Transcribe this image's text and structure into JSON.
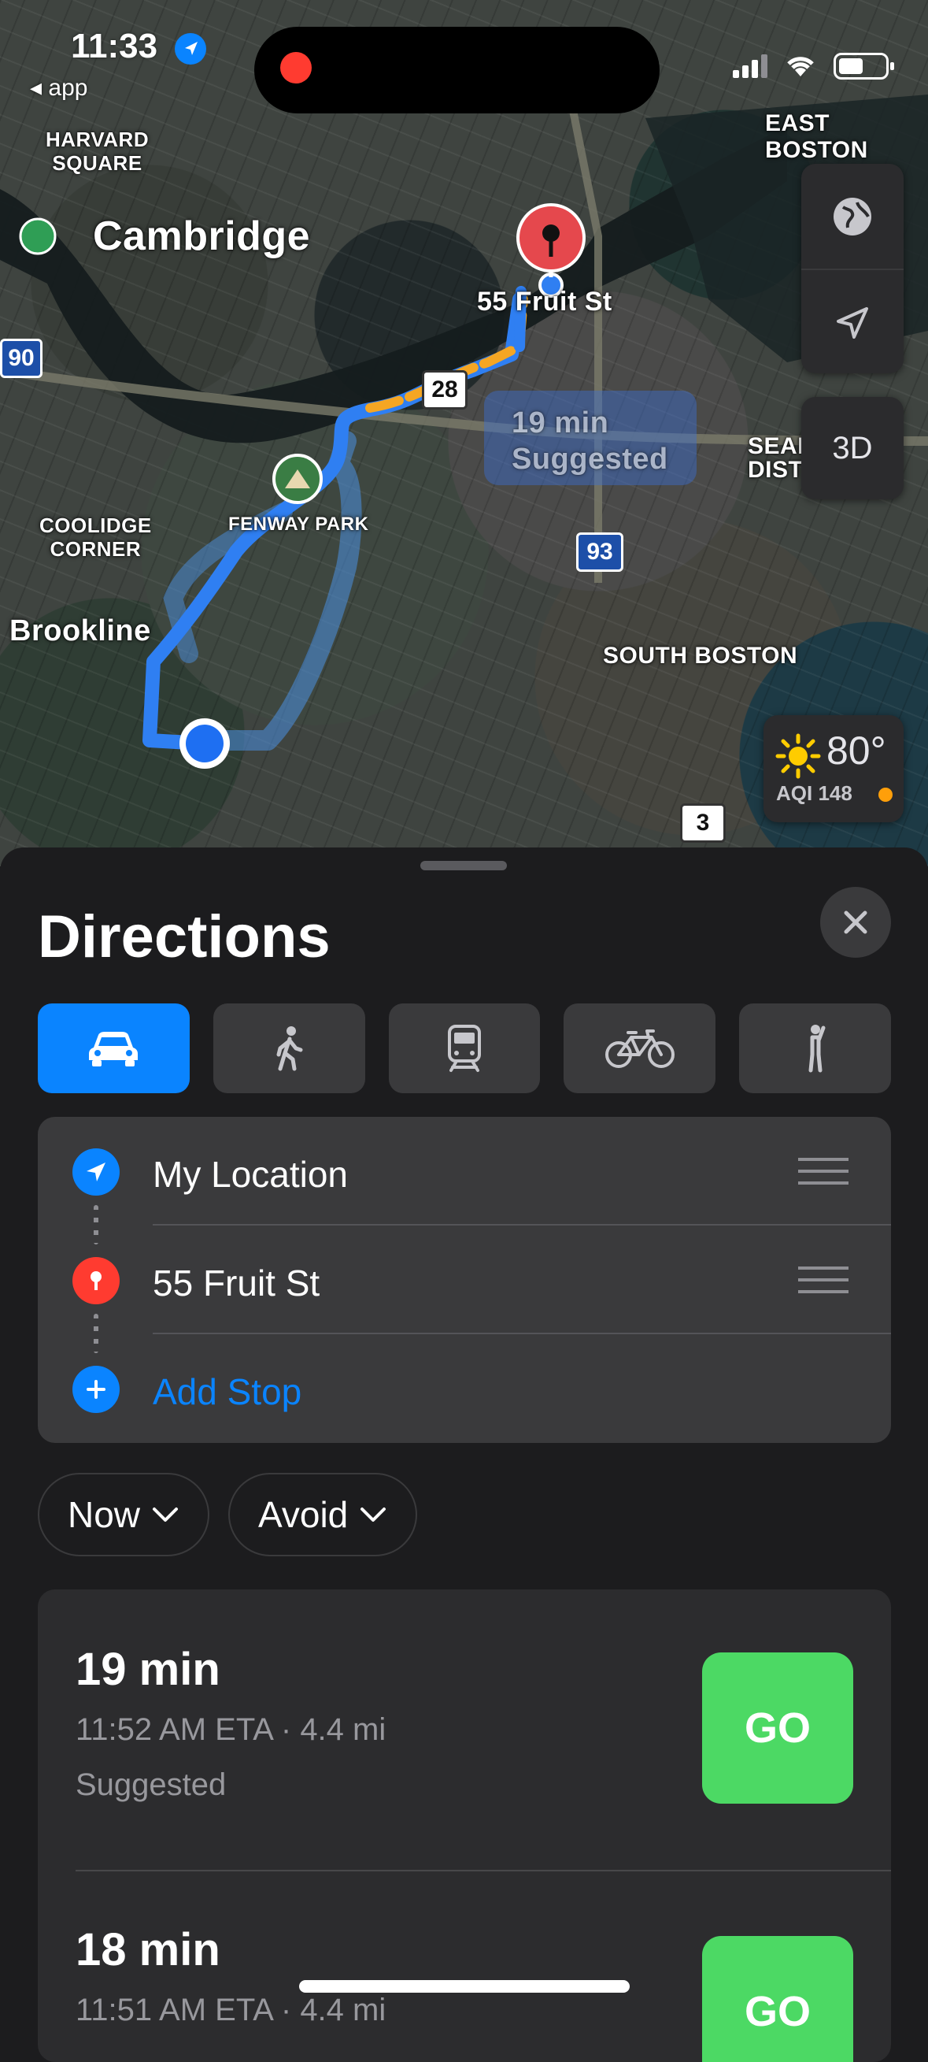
{
  "status_bar": {
    "time": "11:33",
    "back_label": "◂ app"
  },
  "map": {
    "labels": {
      "harvard": "HARVARD\nSQUARE",
      "cambridge": "Cambridge",
      "east_boston": "EAST BOSTON",
      "destination": "55 Fruit St",
      "coolidge": "COOLIDGE\nCORNER",
      "fenway": "FENWAY PARK",
      "brookline": "Brookline",
      "south_boston": "SOUTH BOSTON",
      "seaport": "SEAP\nDIST",
      "route_time": "19 min",
      "route_tag": "Suggested"
    },
    "shields": {
      "i90": "90",
      "r28": "28",
      "i93": "93",
      "r3": "3"
    },
    "controls": {
      "globe_icon": "globe-icon",
      "location_icon": "location-arrow-icon",
      "three_d": "3D"
    },
    "weather": {
      "temp": "80°",
      "aqi": "AQI 148",
      "aqi_color": "#ff9f0a"
    }
  },
  "sheet": {
    "title": "Directions",
    "modes": [
      {
        "name": "drive",
        "icon": "car-icon",
        "active": true
      },
      {
        "name": "walk",
        "icon": "walk-icon",
        "active": false
      },
      {
        "name": "transit",
        "icon": "train-icon",
        "active": false
      },
      {
        "name": "cycle",
        "icon": "bicycle-icon",
        "active": false
      },
      {
        "name": "rideshare",
        "icon": "hail-icon",
        "active": false
      }
    ],
    "stops": {
      "origin": "My Location",
      "destination": "55 Fruit St",
      "add": "Add Stop"
    },
    "filters": {
      "time": "Now",
      "avoid": "Avoid"
    },
    "routes": [
      {
        "time": "19 min",
        "eta": "11:52 AM ETA · 4.4 mi",
        "tag": "Suggested",
        "go": "GO"
      },
      {
        "time": "18 min",
        "eta": "11:51 AM ETA · 4.4 mi",
        "tag": "",
        "go": "GO"
      }
    ]
  },
  "colors": {
    "accent": "#0a84ff",
    "go_green": "#4cd964",
    "route_orange": "#f5a623",
    "pin_red": "#ff3b30"
  }
}
